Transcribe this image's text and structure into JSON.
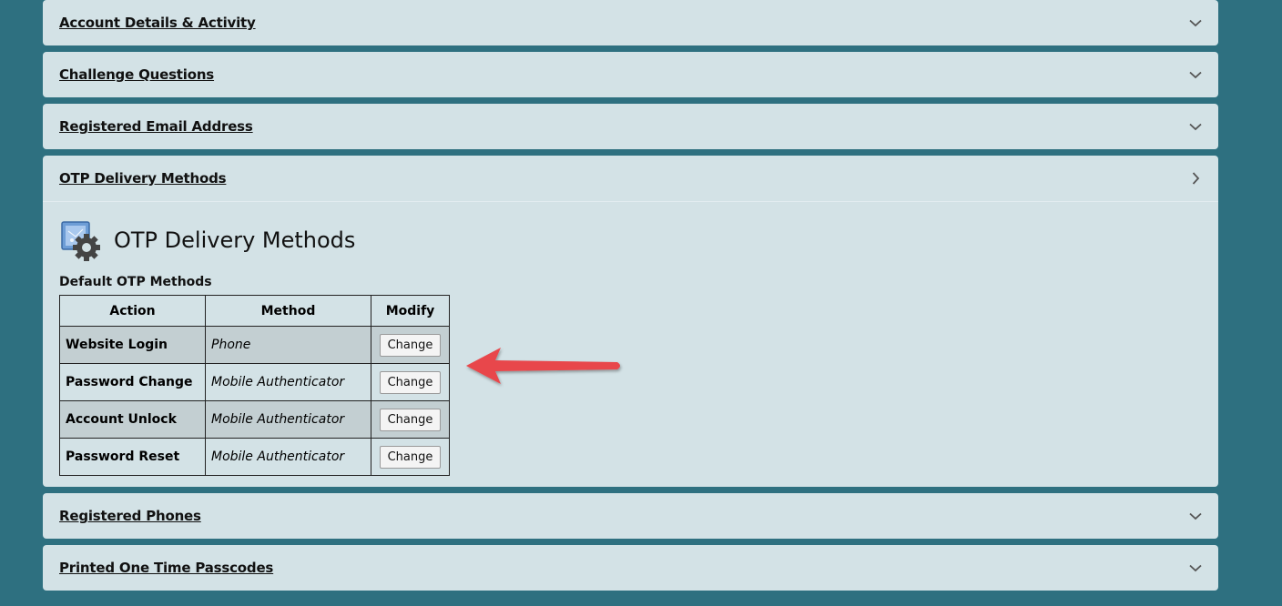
{
  "panels_top": [
    {
      "title": "Account Details & Activity",
      "icon": "chevron-down-icon"
    },
    {
      "title": "Challenge Questions",
      "icon": "chevron-down-icon"
    },
    {
      "title": "Registered Email Address",
      "icon": "chevron-down-icon"
    }
  ],
  "otp_panel": {
    "title": "OTP Delivery Methods",
    "icon": "chevron-right-icon",
    "heading": "OTP Delivery Methods",
    "heading_icon": "settings-gear-icon",
    "subheading": "Default OTP Methods",
    "table": {
      "headers": [
        "Action",
        "Method",
        "Modify"
      ],
      "rows": [
        {
          "action": "Website Login",
          "method": "Phone",
          "button": "Change"
        },
        {
          "action": "Password Change",
          "method": "Mobile Authenticator",
          "button": "Change"
        },
        {
          "action": "Account Unlock",
          "method": "Mobile Authenticator",
          "button": "Change"
        },
        {
          "action": "Password Reset",
          "method": "Mobile Authenticator",
          "button": "Change"
        }
      ]
    }
  },
  "panels_bottom": [
    {
      "title": "Registered Phones",
      "icon": "chevron-down-icon"
    },
    {
      "title": "Printed One Time Passcodes",
      "icon": "chevron-down-icon"
    }
  ],
  "annotation": {
    "icon": "red-arrow-icon",
    "color": "#e8474b"
  },
  "colors": {
    "background": "#2e7080",
    "panel": "#d3e2e6",
    "row_shade": "#c3cfd2"
  }
}
